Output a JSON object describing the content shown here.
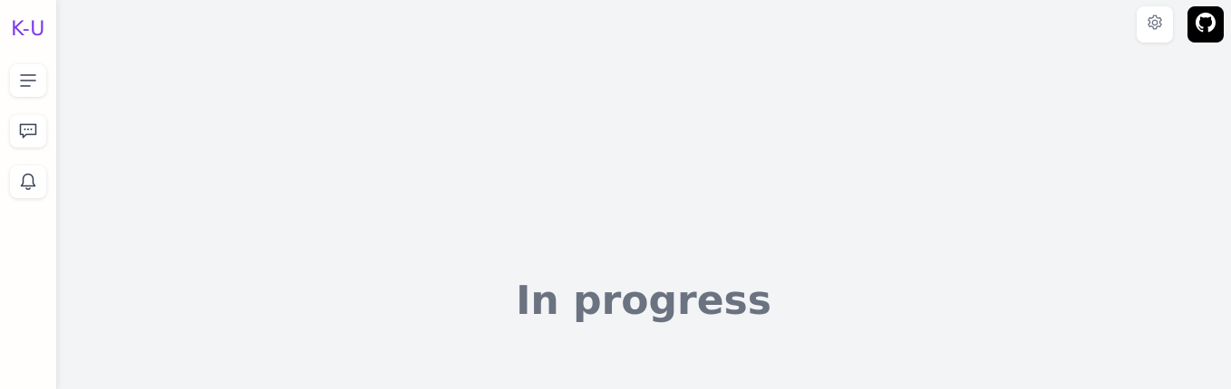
{
  "app": {
    "logo_text": "K-U",
    "accent_color": "#7c3aed"
  },
  "sidebar": {
    "items": [
      {
        "icon": "menu-lines-icon"
      },
      {
        "icon": "chat-bubble-icon"
      },
      {
        "icon": "bell-icon"
      }
    ]
  },
  "header": {
    "buttons": [
      {
        "icon": "gear-icon"
      },
      {
        "icon": "github-icon"
      }
    ]
  },
  "main": {
    "status_text": "In progress",
    "text_color": "#6b7280"
  }
}
